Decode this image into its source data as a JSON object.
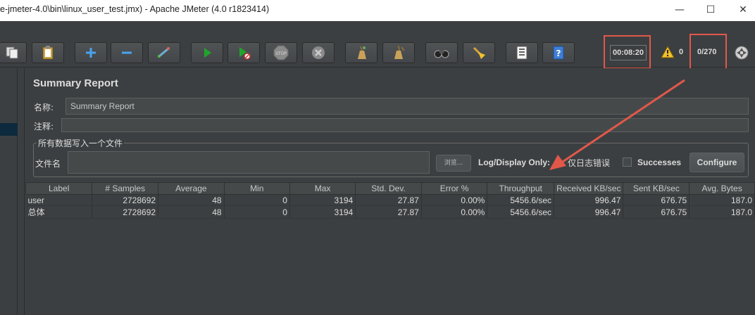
{
  "window": {
    "title": "e-jmeter-4.0\\bin\\linux_user_test.jmx) - Apache JMeter (4.0 r1823414)"
  },
  "toolbar": {
    "elapsed_time": "00:08:20",
    "warning_count": "0",
    "active_threads": "0/270"
  },
  "panel": {
    "title": "Summary Report",
    "name_label": "名称:",
    "name_value": "Summary Report",
    "comment_label": "注释:",
    "comment_value": "",
    "write_group_title": "所有数据写入一个文件",
    "filename_label": "文件名",
    "filename_value": "",
    "browse_label": "浏览...",
    "log_display_only": "Log/Display Only:",
    "errors_only_label": "仅日志错误",
    "successes_label": "Successes",
    "configure_label": "Configure"
  },
  "table": {
    "columns": [
      "Label",
      "# Samples",
      "Average",
      "Min",
      "Max",
      "Std. Dev.",
      "Error %",
      "Throughput",
      "Received KB/sec",
      "Sent KB/sec",
      "Avg. Bytes"
    ],
    "rows": [
      [
        "user",
        "2728692",
        "48",
        "0",
        "3194",
        "27.87",
        "0.00%",
        "5456.6/sec",
        "996.47",
        "676.75",
        "187.0"
      ],
      [
        "总体",
        "2728692",
        "48",
        "0",
        "3194",
        "27.87",
        "0.00%",
        "5456.6/sec",
        "996.47",
        "676.75",
        "187.0"
      ]
    ]
  },
  "icons": [
    "copy-icon",
    "paste-icon",
    "expand-icon",
    "collapse-icon",
    "toggle-icon",
    "start-icon",
    "start-no-pause-icon",
    "stop-icon",
    "shutdown-icon",
    "clear-icon",
    "clear-all-icon",
    "search-icon",
    "reset-search-icon",
    "function-helper-icon",
    "help-icon",
    "warning-icon",
    "remote-icon"
  ],
  "colors": {
    "annotation": "#e1584a",
    "background": "#3c3f41"
  }
}
